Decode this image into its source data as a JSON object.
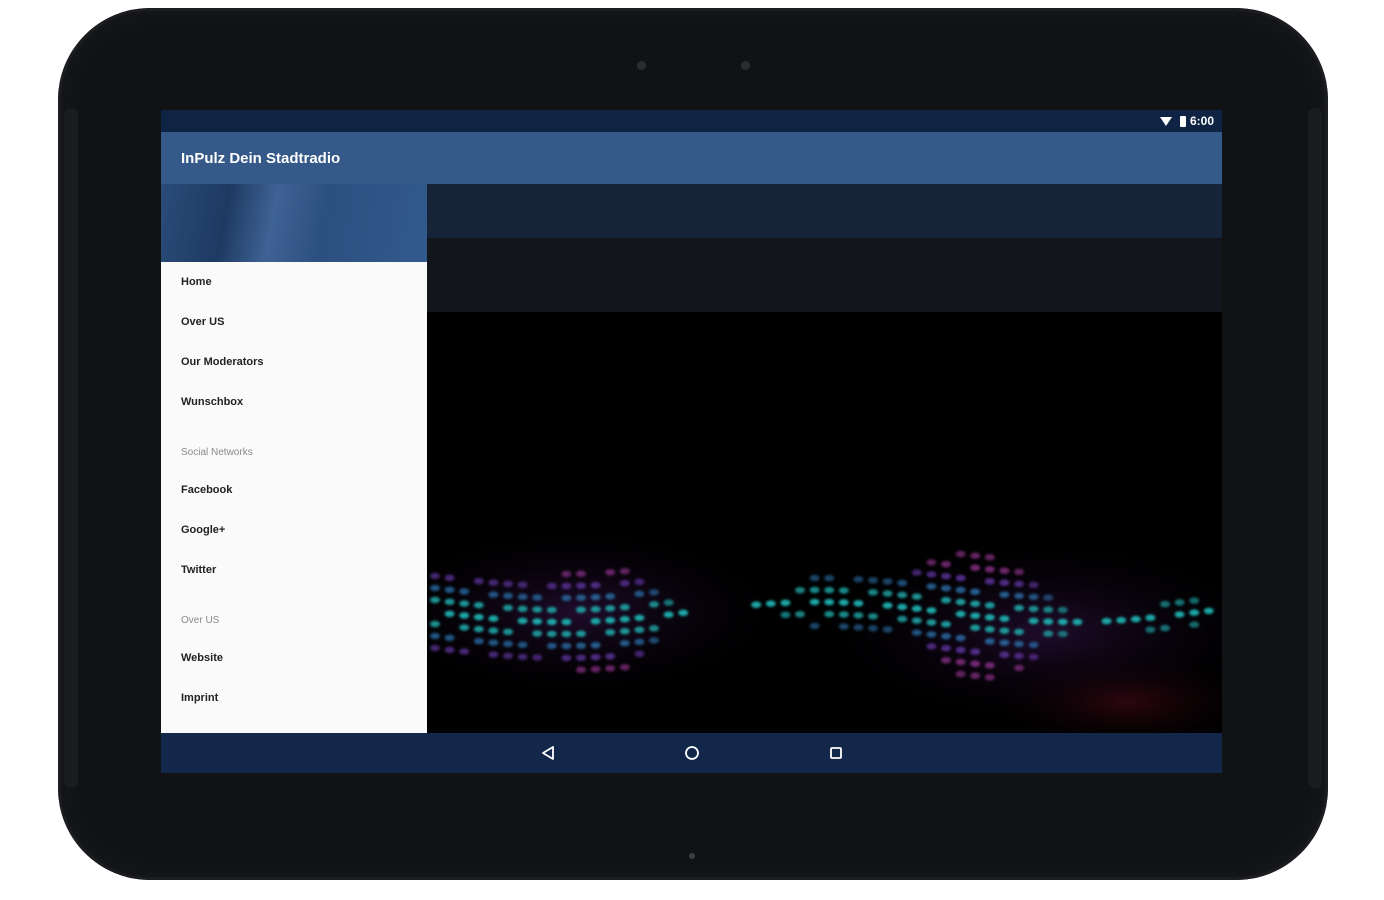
{
  "status_bar": {
    "time": "6:00"
  },
  "app_bar": {
    "title": "InPulz Dein Stadtradio"
  },
  "drawer": {
    "section_main": [
      {
        "label": "Home"
      },
      {
        "label": "Over US"
      },
      {
        "label": "Our Moderators"
      },
      {
        "label": "Wunschbox"
      }
    ],
    "subheader_social": "Social Networks",
    "section_social": [
      {
        "label": "Facebook"
      },
      {
        "label": "Google+"
      },
      {
        "label": "Twitter"
      }
    ],
    "subheader_about": "Over US",
    "section_about": [
      {
        "label": "Website"
      },
      {
        "label": "Imprint"
      }
    ]
  },
  "colors": {
    "status_bar": "#0f2444",
    "app_bar": "#355988",
    "nav_bar": "#12274a",
    "drawer_bg": "#fafafa"
  },
  "icons": {
    "status": [
      "wifi-icon",
      "battery-icon"
    ],
    "nav": [
      "back-icon",
      "home-icon",
      "recents-icon"
    ]
  }
}
